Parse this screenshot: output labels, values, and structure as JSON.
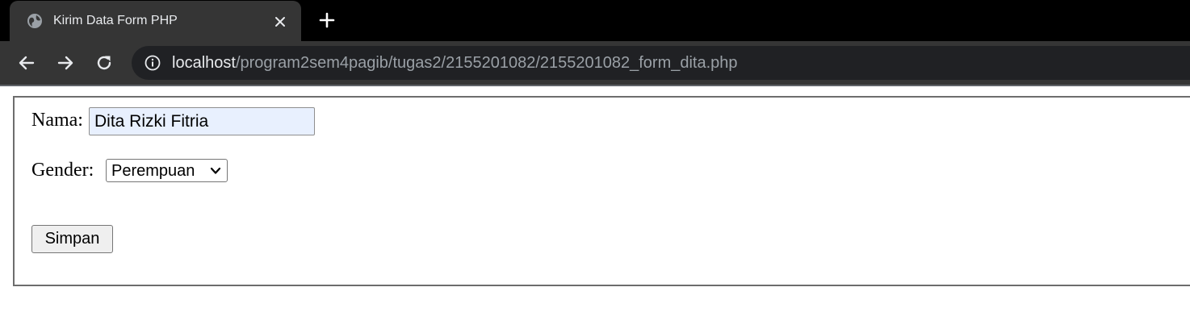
{
  "browser": {
    "tab": {
      "title": "Kirim Data Form PHP",
      "favicon_icon": "globe-icon",
      "close_icon": "close-icon"
    },
    "new_tab_icon": "plus-icon",
    "nav": {
      "back_icon": "arrow-left-icon",
      "forward_icon": "arrow-right-icon",
      "reload_icon": "reload-icon"
    },
    "address_bar": {
      "info_icon": "info-icon",
      "url_host": "localhost",
      "url_path": "/program2sem4pagib/tugas2/2155201082/2155201082_form_dita.php"
    }
  },
  "form": {
    "nama_label": "Nama:",
    "nama_value": "Dita Rizki Fitria",
    "gender_label": "Gender:",
    "gender_selected": "Perempuan",
    "submit_label": "Simpan"
  },
  "colors": {
    "tabstrip": "#000000",
    "toolbar": "#353535",
    "omnibox": "#202124",
    "autofill": "#e8f0fe",
    "form_border": "#6d6d6d"
  }
}
